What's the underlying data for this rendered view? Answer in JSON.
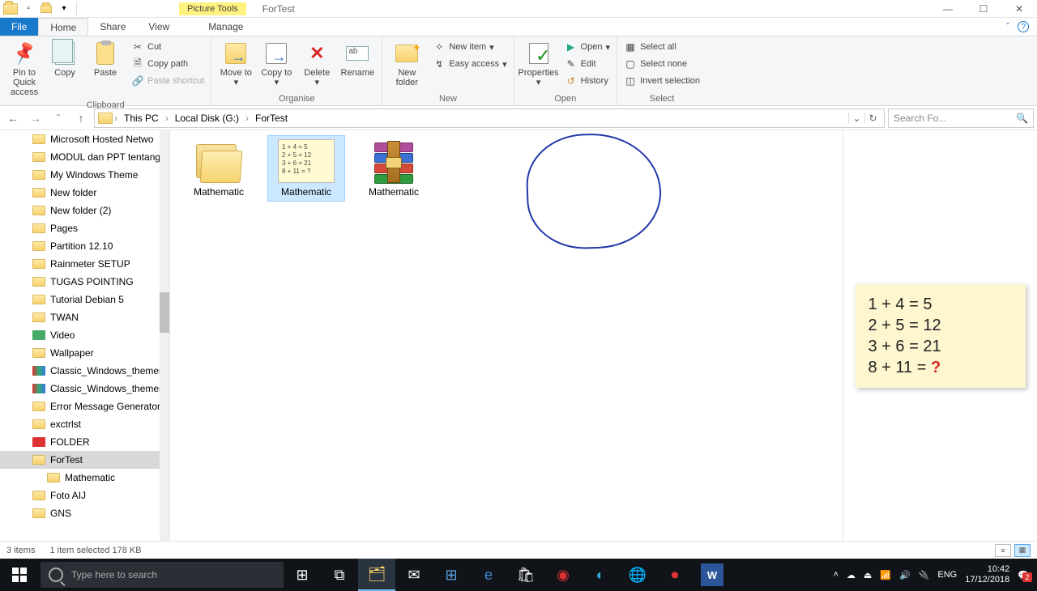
{
  "window": {
    "contextual_tab": "Picture Tools",
    "title": "ForTest",
    "min": "—",
    "max": "☐",
    "close": "✕"
  },
  "ribbon": {
    "tabs": {
      "file": "File",
      "home": "Home",
      "share": "Share",
      "view": "View",
      "manage": "Manage"
    },
    "help_caret": "ˇ",
    "help_q": "?",
    "groups": {
      "clipboard": {
        "pin": "Pin to Quick access",
        "copy": "Copy",
        "paste": "Paste",
        "cut": "Cut",
        "copypath": "Copy path",
        "pasteshort": "Paste shortcut",
        "label": "Clipboard"
      },
      "organise": {
        "moveto": "Move to",
        "copyto": "Copy to",
        "delete": "Delete",
        "rename": "Rename",
        "label": "Organise"
      },
      "new": {
        "newfolder": "New folder",
        "newitem": "New item",
        "easy": "Easy access",
        "label": "New"
      },
      "open": {
        "properties": "Properties",
        "open": "Open",
        "edit": "Edit",
        "history": "History",
        "label": "Open"
      },
      "select": {
        "all": "Select all",
        "none": "Select none",
        "invert": "Invert selection",
        "label": "Select"
      }
    }
  },
  "breadcrumb": {
    "pc": "This PC",
    "disk": "Local Disk (G:)",
    "folder": "ForTest",
    "sep": "›"
  },
  "nav": {
    "back": "←",
    "fwd": "→",
    "up": "↑",
    "caret": "ˇ",
    "refresh": "↻"
  },
  "search": {
    "placeholder": "Search Fo...",
    "icon": "🔍"
  },
  "tree": [
    {
      "label": "Microsoft Hosted Netwo",
      "ico": "f"
    },
    {
      "label": "MODUL dan PPT tentang",
      "ico": "f"
    },
    {
      "label": "My Windows Theme",
      "ico": "f"
    },
    {
      "label": "New folder",
      "ico": "f"
    },
    {
      "label": "New folder (2)",
      "ico": "f"
    },
    {
      "label": "Pages",
      "ico": "f"
    },
    {
      "label": "Partition 12.10",
      "ico": "f"
    },
    {
      "label": "Rainmeter SETUP",
      "ico": "f"
    },
    {
      "label": "TUGAS POINTING",
      "ico": "f"
    },
    {
      "label": "Tutorial Debian 5",
      "ico": "f"
    },
    {
      "label": "TWAN",
      "ico": "f"
    },
    {
      "label": "Video",
      "ico": "v"
    },
    {
      "label": "Wallpaper",
      "ico": "f"
    },
    {
      "label": "Classic_Windows_themes",
      "ico": "p"
    },
    {
      "label": "Classic_Windows_themes",
      "ico": "p"
    },
    {
      "label": "Error Message Generator",
      "ico": "f"
    },
    {
      "label": "exctrlst",
      "ico": "f"
    },
    {
      "label": "FOLDER",
      "ico": "r"
    },
    {
      "label": "ForTest",
      "ico": "f",
      "sel": true
    },
    {
      "label": "Mathematic",
      "ico": "f",
      "ind": true
    },
    {
      "label": "Foto AIJ",
      "ico": "f"
    },
    {
      "label": "GNS",
      "ico": "f"
    }
  ],
  "items": {
    "folder": "Mathematic",
    "image": "Mathematic",
    "rar": "Mathematic",
    "thumb_lines": [
      "1 + 4 = 5",
      "2 + 5 = 12",
      "3 + 6 = 21",
      "8 + 11 = ?"
    ]
  },
  "preview": {
    "l1": "1 + 4 = 5",
    "l2": "2 + 5 = 12",
    "l3": "3 + 6 = 21",
    "l4a": "8 + 11 = ",
    "l4q": "?"
  },
  "status": {
    "count": "3 items",
    "sel": "1 item selected  178 KB"
  },
  "taskbar": {
    "search_ph": "Type here to search",
    "lang": "ENG",
    "time": "10:42",
    "date": "17/12/2018"
  }
}
